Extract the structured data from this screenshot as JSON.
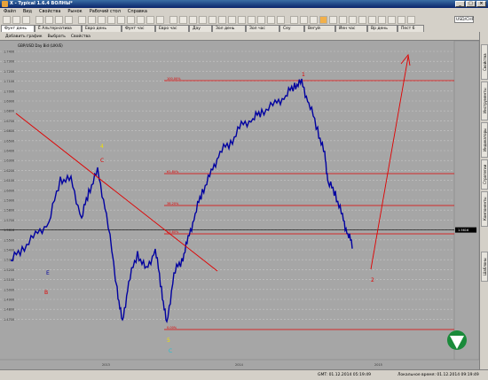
{
  "window": {
    "title": "X - Typical 1.6.4 ВОЛНЫ*"
  },
  "menu": [
    "Файл",
    "Вид",
    "Свойства",
    "Рынок",
    "Рабочий стол",
    "Справка"
  ],
  "toolbar": {
    "symbol": "USD/CHF"
  },
  "tabs": [
    "Фунт день",
    "Ё Альтернатива",
    "Евро день",
    "Фунт час",
    "Евро час",
    "Дау",
    "Зол день",
    "Зол час",
    "Сеу",
    "Вегуй",
    "Йен час",
    "Вр день",
    "Пест 6"
  ],
  "chart_toolbar": {
    "add_chart": "Добавить график",
    "select": "Выбрать",
    "properties": "Свойства"
  },
  "chart": {
    "instrument": "GBP/USD Day Bid (LIKVE)",
    "current_price": "1.5616",
    "x_labels": [
      "2013",
      "2014",
      "2015"
    ],
    "fib_levels": [
      "0.00%",
      "23.60%",
      "38.20%",
      "61.80%",
      "100.00%"
    ],
    "wave_labels": {
      "w1": "1",
      "w2": "2",
      "w4": "4",
      "wC": "C",
      "wB": "B",
      "w5": "5",
      "wCbottom": "C",
      "wE": "E"
    },
    "y_labels": [
      "1.7400",
      "1.7300",
      "1.7200",
      "1.7100",
      "1.7000",
      "1.6900",
      "1.6800",
      "1.6700",
      "1.6600",
      "1.6500",
      "1.6400",
      "1.6300",
      "1.6200",
      "1.6100",
      "1.6000",
      "1.5900",
      "1.5800",
      "1.5700",
      "1.5616",
      "1.5500",
      "1.5400",
      "1.5300",
      "1.5200",
      "1.5100",
      "1.5000",
      "1.4900",
      "1.4800",
      "1.4700"
    ],
    "colors": {
      "background": "#a6a6a6",
      "candles": "#0000a0",
      "fib": "#e00000",
      "wave_yellow": "#f0e000",
      "wave_red": "#e00000",
      "wave_cyan": "#20c0d0"
    }
  },
  "right_panel": [
    "Свойства",
    "Инструменты",
    "Индикаторы",
    "Стратегии",
    "Компоненты",
    "Шаблоны"
  ],
  "status": {
    "server_time": "GMT: 01.12.2014 05:19:49",
    "local_time": "Локальное время: 01.12.2014 09:19:49"
  }
}
